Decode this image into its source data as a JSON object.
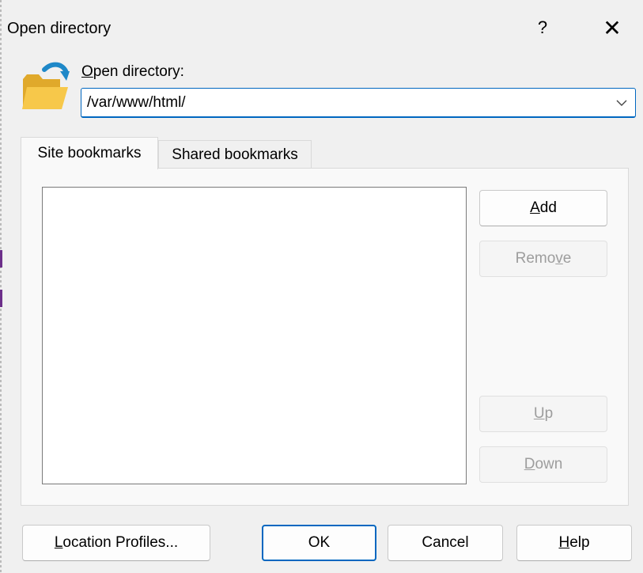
{
  "window": {
    "title": "Open directory",
    "help_glyph": "?",
    "close_glyph": "✕"
  },
  "directory": {
    "label_first": "O",
    "label_rest": "pen directory:",
    "value": "/var/www/html/"
  },
  "tabs": [
    {
      "label": "Site bookmarks",
      "active": true
    },
    {
      "label": "Shared bookmarks",
      "active": false
    }
  ],
  "bookmarks": [],
  "side_buttons": {
    "add": {
      "pre": "",
      "u": "A",
      "post": "dd",
      "enabled": true
    },
    "remove": {
      "pre": "Remo",
      "u": "v",
      "post": "e",
      "enabled": false
    },
    "up": {
      "pre": "",
      "u": "U",
      "post": "p",
      "enabled": false
    },
    "down": {
      "pre": "",
      "u": "D",
      "post": "own",
      "enabled": false
    }
  },
  "footer_buttons": {
    "profiles": {
      "pre": "",
      "u": "L",
      "post": "ocation Profiles..."
    },
    "ok": {
      "label": "OK"
    },
    "cancel": {
      "label": "Cancel"
    },
    "help": {
      "pre": "",
      "u": "H",
      "post": "elp"
    }
  },
  "colors": {
    "accent": "#0067c0",
    "folder_yellow": "#f5c243",
    "arrow_blue": "#1e88c8"
  },
  "icons": {
    "folder": "open-folder-icon",
    "dropdown": "chevron-down-icon"
  }
}
